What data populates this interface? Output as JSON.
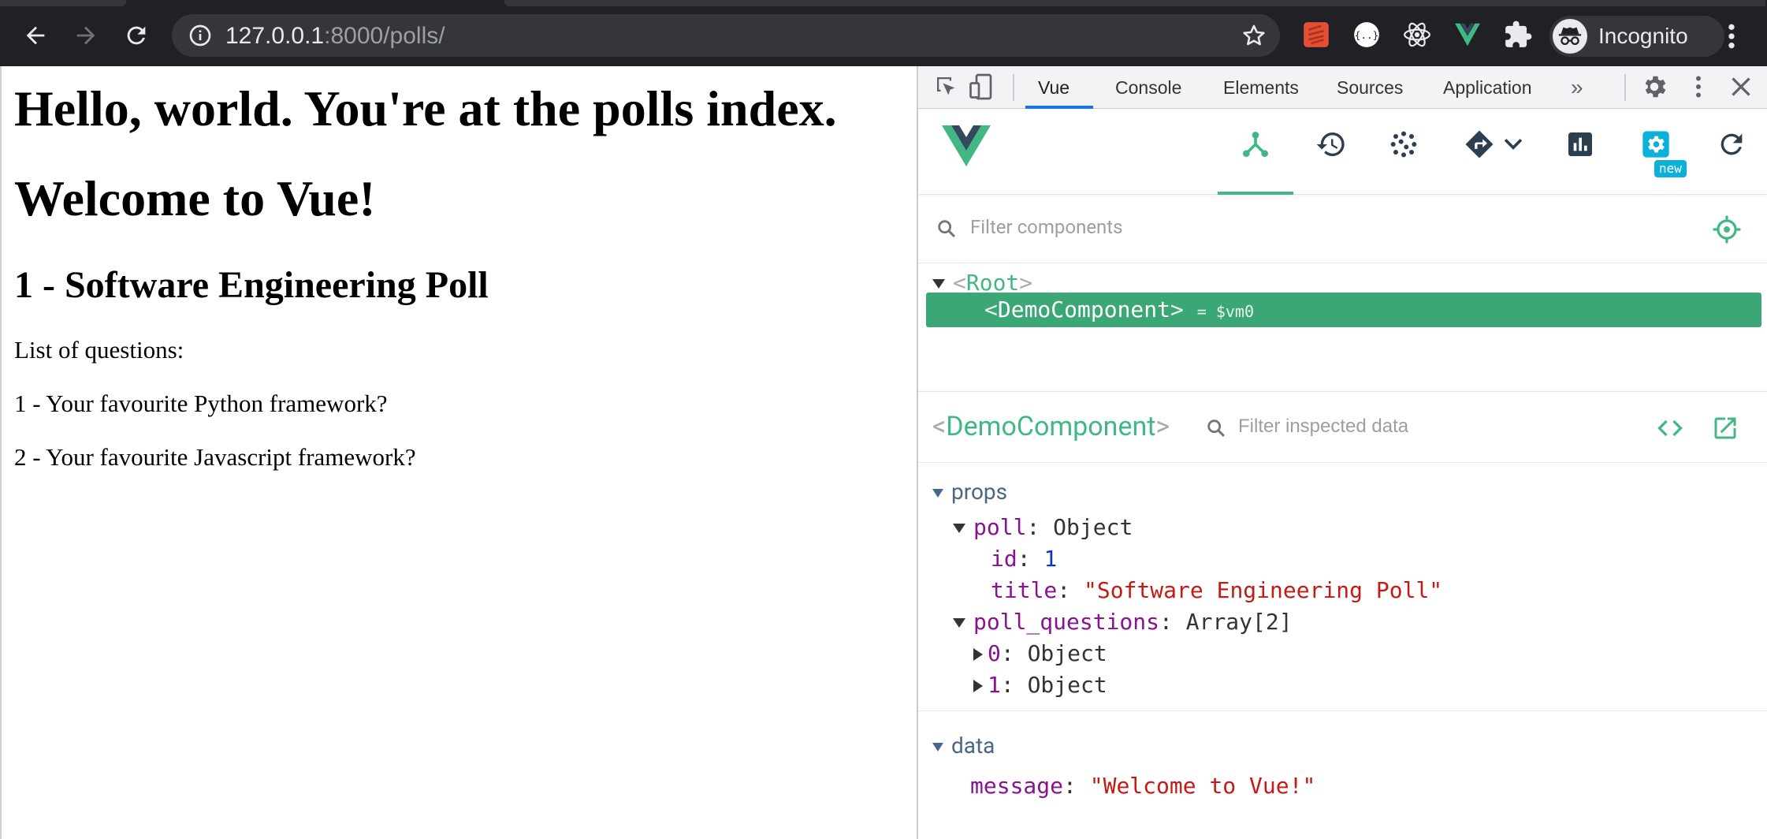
{
  "browser": {
    "url_host": "127.0.0.1",
    "url_rest": ":8000/polls/",
    "profile_label": "Incognito",
    "icons": {
      "back": "back-arrow-icon",
      "forward": "forward-arrow-icon",
      "reload": "reload-icon",
      "site_info": "info-icon",
      "bookmark": "star-icon",
      "extensions": [
        "rst-extension-icon",
        "json-extension-icon",
        "react-devtools-icon",
        "vue-devtools-icon",
        "puzzle-icon"
      ],
      "profile": "incognito-icon",
      "menu": "more-vertical-icon"
    }
  },
  "page": {
    "heading1": "Hello, world. You're at the polls index.",
    "heading2": "Welcome to Vue!",
    "poll_heading": "1 - Software Engineering Poll",
    "list_label": "List of questions:",
    "questions": [
      "1 - Your favourite Python framework?",
      "2 - Your favourite Javascript framework?"
    ]
  },
  "devtools": {
    "tabs": [
      "Vue",
      "Console",
      "Elements",
      "Sources",
      "Application"
    ],
    "active_tab": "Vue",
    "overflow": "»",
    "vue": {
      "accent": "#41b883",
      "toolbar_icons": [
        "components-icon",
        "timeline-icon",
        "vuex-icon",
        "router-icon",
        "performance-icon",
        "settings-icon",
        "refresh-icon"
      ],
      "new_badge": "new",
      "filter_components_placeholder": "Filter components",
      "tree": {
        "root_tag": "Root",
        "selected_tag": "DemoComponent",
        "selected_vm": "= $vm0"
      },
      "inspector": {
        "component_name": "DemoComponent",
        "filter_placeholder": "Filter inspected data",
        "props_label": "props",
        "poll_key": "poll",
        "poll_type": "Object",
        "id_key": "id",
        "id_value": "1",
        "title_key": "title",
        "title_value": "\"Software Engineering Poll\"",
        "questions_key": "poll_questions",
        "questions_type": "Array[2]",
        "item0_key": "0",
        "item0_type": "Object",
        "item1_key": "1",
        "item1_type": "Object",
        "data_label": "data",
        "message_key": "message",
        "message_value": "\"Welcome to Vue!\""
      }
    }
  }
}
